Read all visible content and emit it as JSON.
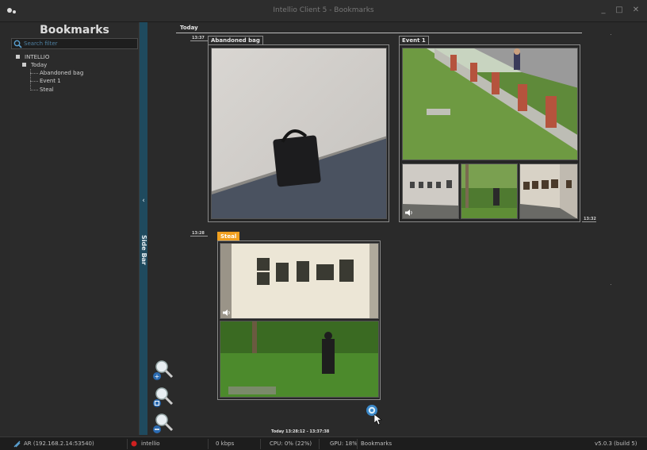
{
  "window": {
    "title": "Intellio Client 5 - Bookmarks"
  },
  "bookmarks_panel": {
    "title": "Bookmarks",
    "search_placeholder": "Search filter",
    "tree": {
      "root": "INTELLIO",
      "group": "Today",
      "items": [
        "Abandoned bag",
        "Event 1",
        "Steal"
      ]
    }
  },
  "side_bar": {
    "label": "Side Bar",
    "arrow": "‹"
  },
  "timeline": {
    "day": "Today",
    "row1_time": "13:37",
    "row2_time": "13:28",
    "event1_end_time": "13:32",
    "events": [
      {
        "label": "Abandoned bag",
        "selected": false
      },
      {
        "label": "Event 1",
        "selected": false
      },
      {
        "label": "Steal",
        "selected": true
      }
    ],
    "selected_range": "Today 13:28:12 - 13:37:38"
  },
  "status_bar": {
    "connection": "AR (192.168.2.14:53540)",
    "user": "intellio",
    "bandwidth": "0 kbps",
    "cpu": "CPU: 0% (22%)",
    "gpu": "GPU: 18%",
    "view": "Bookmarks",
    "version": "v5.0.3 (build 5)"
  },
  "colors": {
    "accent_orange": "#f0a020",
    "sidebar_blue": "#1f4a5e",
    "record_red": "#d02020"
  },
  "icons": {
    "zoom_in": "zoom-in-icon",
    "zoom_reset": "zoom-reset-icon",
    "zoom_out": "zoom-out-icon",
    "settings": "settings-icon",
    "search": "search-icon",
    "speaker": "speaker-icon"
  }
}
